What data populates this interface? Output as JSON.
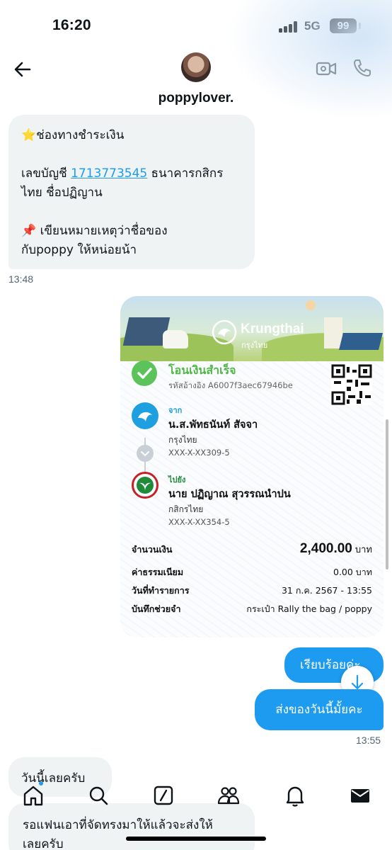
{
  "status_bar": {
    "time": "16:20",
    "network": "5G",
    "battery": "99"
  },
  "header": {
    "username": "poppylover."
  },
  "messages": {
    "incoming_1": {
      "line1": "⭐️ช่องทางชำระเงิน",
      "line2_prefix": "เลขบัญชี ",
      "account_number": "1713773545",
      "line2_suffix": " ธนาคารกสิกร",
      "line3": "ไทย ชื่อปฏิญาน",
      "line4": "📌 เขียนหมายเหตุว่าชื่อของ",
      "line5": "กับpoppy ให้หน่อยน้า",
      "time": "13:48"
    },
    "outgoing_1": {
      "text": "เรียบร้อยค่ะ"
    },
    "outgoing_2": {
      "text": "ส่งของวันนี้มั้ยคะ",
      "time": "13:55"
    },
    "incoming_2": {
      "text": "วันนี้เลยครับ"
    },
    "incoming_3": {
      "line1": "รอแฟนเอาที่จัดทรงมาให้แล้วจะส่งให้",
      "line2": "เลยครับ"
    }
  },
  "receipt": {
    "bank_name": "Krungthai",
    "bank_name_th": "กรุงไทย",
    "status": "โอนเงินสำเร็จ",
    "reference": "รหัสอ้างอิง A6007f3aec67946be",
    "from": {
      "tag": "จาก",
      "name": "น.ส.พัทธนันท์ สัจจา",
      "bank": "กรุงไทย",
      "account": "XXX-X-XX309-5"
    },
    "to": {
      "tag": "ไปยัง",
      "name": "นาย ปฏิญาณ สุวรรณนำปน",
      "bank": "กสิกรไทย",
      "account": "XXX-X-XX354-5"
    },
    "amount_label": "จำนวนเงิน",
    "amount": "2,400.00",
    "currency": "บาท",
    "fee_label": "ค่าธรรมเนียม",
    "fee": "0.00 บาท",
    "date_label": "วันที่ทำรายการ",
    "date": "31 ก.ค. 2567 - 13:55",
    "memo_label": "บันทึกช่วยจำ",
    "memo": "กระเป๋า Rally the bag / poppy"
  },
  "icons": {
    "back": "arrow-left-icon",
    "video": "video-camera-icon",
    "phone": "phone-icon",
    "scroll_down": "arrow-down-icon",
    "home": "home-icon",
    "search": "search-icon",
    "grok": "slash-box-icon",
    "communities": "people-icon",
    "notifications": "bell-icon",
    "messages": "envelope-icon"
  },
  "colors": {
    "accent": "#1d9bf0",
    "success": "#5cc35b",
    "bubble_in": "#eff3f4"
  }
}
